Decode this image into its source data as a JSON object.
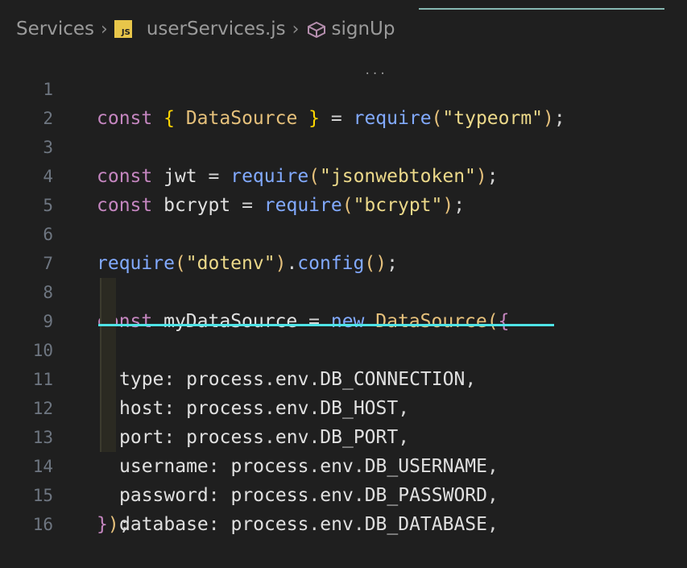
{
  "breadcrumb": {
    "folder": "Services",
    "file_badge": "JS",
    "file": "userServices.js",
    "symbol": "signUp"
  },
  "code": {
    "line_numbers": [
      "1",
      "2",
      "3",
      "4",
      "5",
      "6",
      "7",
      "8",
      "9",
      "10",
      "11",
      "12",
      "13",
      "14",
      "15",
      "16"
    ],
    "l1": {
      "kw": "const",
      "open": "{",
      "name": "DataSource",
      "close": "}",
      "eq": "=",
      "fn": "require",
      "lp": "(",
      "str": "\"typeorm\"",
      "rp": ")",
      "semi": ";"
    },
    "l3": {
      "kw": "const",
      "name": "jwt",
      "eq": "=",
      "fn": "require",
      "lp": "(",
      "str": "\"jsonwebtoken\"",
      "rp": ")",
      "semi": ";"
    },
    "l4": {
      "kw": "const",
      "name": "bcrypt",
      "eq": "=",
      "fn": "require",
      "lp": "(",
      "str": "\"bcrypt\"",
      "rp": ")",
      "semi": ";"
    },
    "l6": {
      "fn": "require",
      "lp": "(",
      "str": "\"dotenv\"",
      "rp": ")",
      "dot": ".",
      "method": "config",
      "call": "()",
      "semi": ";"
    },
    "l8": {
      "kw": "const",
      "name": "myDataSource",
      "eq": "=",
      "new": "new",
      "cls": "DataSource",
      "lp": "(",
      "open": "{"
    },
    "props": [
      {
        "key": "type",
        "obj": "process",
        "env": "env",
        "var": "DB_CONNECTION"
      },
      {
        "key": "host",
        "obj": "process",
        "env": "env",
        "var": "DB_HOST"
      },
      {
        "key": "port",
        "obj": "process",
        "env": "env",
        "var": "DB_PORT"
      },
      {
        "key": "username",
        "obj": "process",
        "env": "env",
        "var": "DB_USERNAME"
      },
      {
        "key": "password",
        "obj": "process",
        "env": "env",
        "var": "DB_PASSWORD"
      },
      {
        "key": "database",
        "obj": "process",
        "env": "env",
        "var": "DB_DATABASE"
      }
    ],
    "l15": {
      "close": "}",
      "rp": ")",
      "semi": ";"
    },
    "hover_dots": "..."
  },
  "colors": {
    "background": "#1f1f1f",
    "keyword": "#c586c0",
    "function": "#82aaff",
    "class": "#e5c07b",
    "string": "#ecd98a",
    "cursor_highlight": "#4ee3e6"
  },
  "icons": {
    "file_icon": "js-file-icon",
    "symbol_icon": "method-symbol-icon",
    "separator_icon": "chevron-right-icon"
  }
}
